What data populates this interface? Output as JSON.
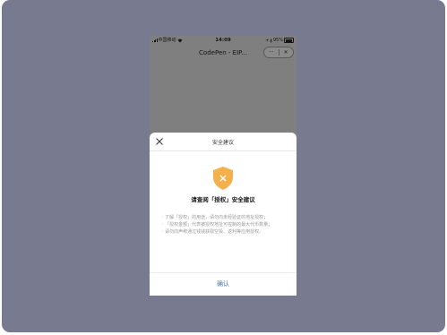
{
  "statusbar": {
    "carrier": "中国移动",
    "time": "14:09",
    "battery": "95%"
  },
  "navbar": {
    "title": "CodePen - EIP...",
    "more_label": "···",
    "close_label": "✕"
  },
  "sheet": {
    "header_title": "安全建议",
    "headline": "请查阅「授权」安全建议",
    "items": [
      "· 了解「授权」的用途，请勿向未经验证的地址授权；",
      "· 「授权金额」代表被授权地址可控制的最大代币数量；",
      "· 请勿向声称通过钱钱获取空投、返利等应用授权。"
    ],
    "confirm_label": "确认"
  },
  "colors": {
    "backdrop": "#787a8f",
    "overlay": "#7f7f7f",
    "shield": "#f5b04e",
    "link": "#4b78b4"
  }
}
